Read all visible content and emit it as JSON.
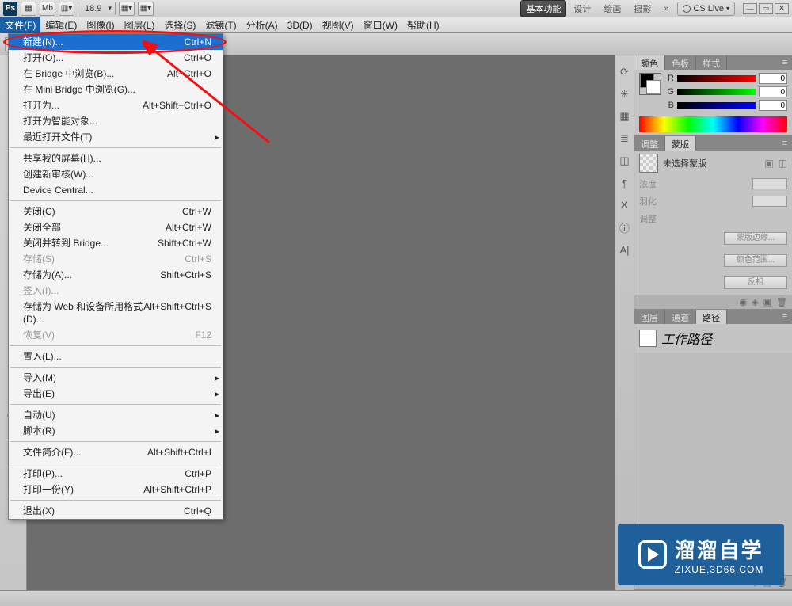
{
  "topbar": {
    "logo": "Ps",
    "zoom": "18.9",
    "workspaces": [
      "基本功能",
      "设计",
      "绘画",
      "摄影"
    ],
    "active_workspace": 0,
    "cslive": "CS Live"
  },
  "menubar": {
    "items": [
      "文件(F)",
      "编辑(E)",
      "图像(I)",
      "图层(L)",
      "选择(S)",
      "滤镜(T)",
      "分析(A)",
      "3D(D)",
      "视图(V)",
      "窗口(W)",
      "帮助(H)"
    ],
    "open_index": 0
  },
  "dropdown": {
    "groups": [
      [
        {
          "label": "新建(N)...",
          "shortcut": "Ctrl+N",
          "highlight": true
        },
        {
          "label": "打开(O)...",
          "shortcut": "Ctrl+O"
        },
        {
          "label": "在 Bridge 中浏览(B)...",
          "shortcut": "Alt+Ctrl+O"
        },
        {
          "label": "在 Mini Bridge 中浏览(G)..."
        },
        {
          "label": "打开为...",
          "shortcut": "Alt+Shift+Ctrl+O"
        },
        {
          "label": "打开为智能对象..."
        },
        {
          "label": "最近打开文件(T)",
          "submenu": true
        }
      ],
      [
        {
          "label": "共享我的屏幕(H)..."
        },
        {
          "label": "创建新审核(W)..."
        },
        {
          "label": "Device Central..."
        }
      ],
      [
        {
          "label": "关闭(C)",
          "shortcut": "Ctrl+W"
        },
        {
          "label": "关闭全部",
          "shortcut": "Alt+Ctrl+W"
        },
        {
          "label": "关闭并转到 Bridge...",
          "shortcut": "Shift+Ctrl+W"
        },
        {
          "label": "存储(S)",
          "shortcut": "Ctrl+S",
          "disabled": true
        },
        {
          "label": "存储为(A)...",
          "shortcut": "Shift+Ctrl+S"
        },
        {
          "label": "签入(I)...",
          "disabled": true
        },
        {
          "label": "存储为 Web 和设备所用格式(D)...",
          "shortcut": "Alt+Shift+Ctrl+S"
        },
        {
          "label": "恢复(V)",
          "shortcut": "F12",
          "disabled": true
        }
      ],
      [
        {
          "label": "置入(L)..."
        }
      ],
      [
        {
          "label": "导入(M)",
          "submenu": true
        },
        {
          "label": "导出(E)",
          "submenu": true
        }
      ],
      [
        {
          "label": "自动(U)",
          "submenu": true
        },
        {
          "label": "脚本(R)",
          "submenu": true
        }
      ],
      [
        {
          "label": "文件简介(F)...",
          "shortcut": "Alt+Shift+Ctrl+I"
        }
      ],
      [
        {
          "label": "打印(P)...",
          "shortcut": "Ctrl+P"
        },
        {
          "label": "打印一份(Y)",
          "shortcut": "Alt+Shift+Ctrl+P"
        }
      ],
      [
        {
          "label": "退出(X)",
          "shortcut": "Ctrl+Q"
        }
      ]
    ]
  },
  "color_panel": {
    "tabs": [
      "颜色",
      "色板",
      "样式"
    ],
    "channels": {
      "r": "R",
      "g": "G",
      "b": "B"
    },
    "values": {
      "r": "0",
      "g": "0",
      "b": "0"
    }
  },
  "mask_panel": {
    "tabs": [
      "调整",
      "蒙版"
    ],
    "title": "未选择蒙版",
    "rows": {
      "density": "浓度",
      "feather": "羽化",
      "adjust": "调整"
    },
    "buttons": {
      "edge": "蒙版边缘...",
      "colorrange": "颜色范围...",
      "invert": "反相"
    }
  },
  "paths_panel": {
    "tabs": [
      "图层",
      "通道",
      "路径"
    ],
    "item": "工作路径"
  },
  "watermark": {
    "big": "溜溜自学",
    "small": "ZIXUE.3D66.COM"
  }
}
